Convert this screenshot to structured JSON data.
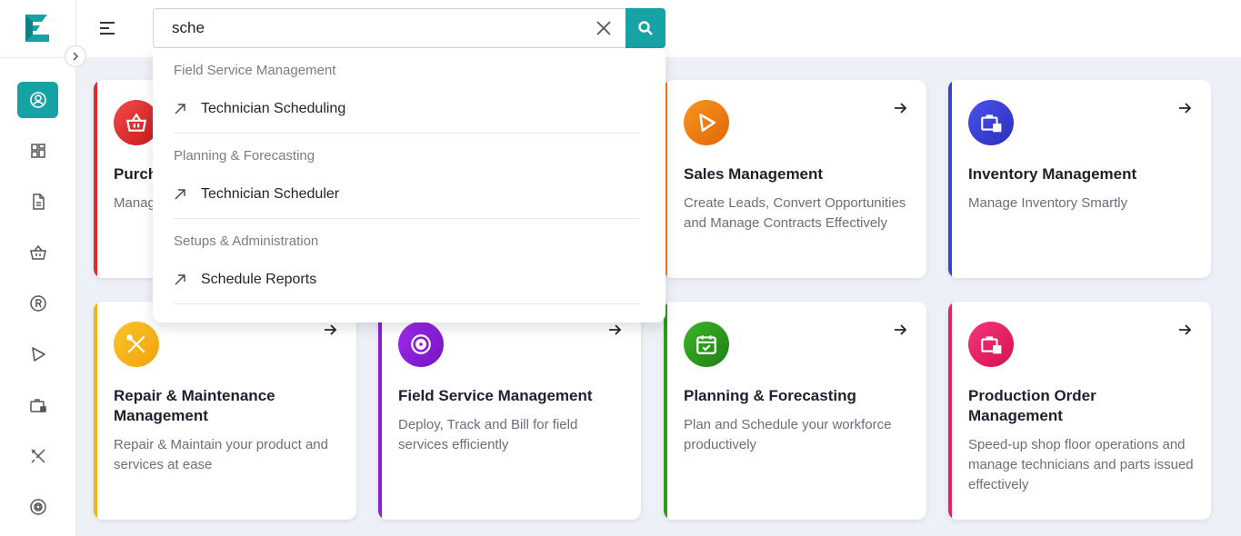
{
  "search": {
    "value": "sche",
    "placeholder": ""
  },
  "dropdown": {
    "groups": [
      {
        "category": "Field Service Management",
        "item": "Technician Scheduling"
      },
      {
        "category": "Planning & Forecasting",
        "item": "Technician Scheduler"
      },
      {
        "category": "Setups & Administration",
        "item": "Schedule Reports"
      }
    ]
  },
  "sidebar": {
    "items": [
      {
        "icon": "user-circle-icon",
        "active": true
      },
      {
        "icon": "dashboard-icon"
      },
      {
        "icon": "document-icon"
      },
      {
        "icon": "basket-icon"
      },
      {
        "icon": "registered-icon"
      },
      {
        "icon": "play-icon"
      },
      {
        "icon": "briefcase-icon"
      },
      {
        "icon": "tools-icon"
      },
      {
        "icon": "target-icon"
      }
    ]
  },
  "cards": [
    {
      "title": "Purchase",
      "desc": "Manage",
      "color": "#e02a2a"
    },
    {
      "title": "Sales Management",
      "desc": "Create Leads, Convert Opportunities and Manage Contracts Effectively",
      "color": "#f07a12"
    },
    {
      "title": "Inventory Management",
      "desc": "Manage Inventory Smartly",
      "color": "#3b3fd8"
    },
    {
      "title": "Repair & Maintenance Management",
      "desc": "Repair & Maintain your product and services at ease",
      "color": "#f5b313"
    },
    {
      "title": "Field Service Management",
      "desc": "Deploy, Track and Bill for field services efficiently",
      "color": "#8b1ed8"
    },
    {
      "title": "Planning & Forecasting",
      "desc": "Plan and Schedule your workforce productively",
      "color": "#2e9b1e"
    },
    {
      "title": "Production Order Management",
      "desc": "Speed-up shop floor operations and manage technicians and parts issued effectively",
      "color": "#ec1e63"
    }
  ],
  "colors": {
    "accent": "#17a2a6",
    "background": "#eef0f8"
  }
}
